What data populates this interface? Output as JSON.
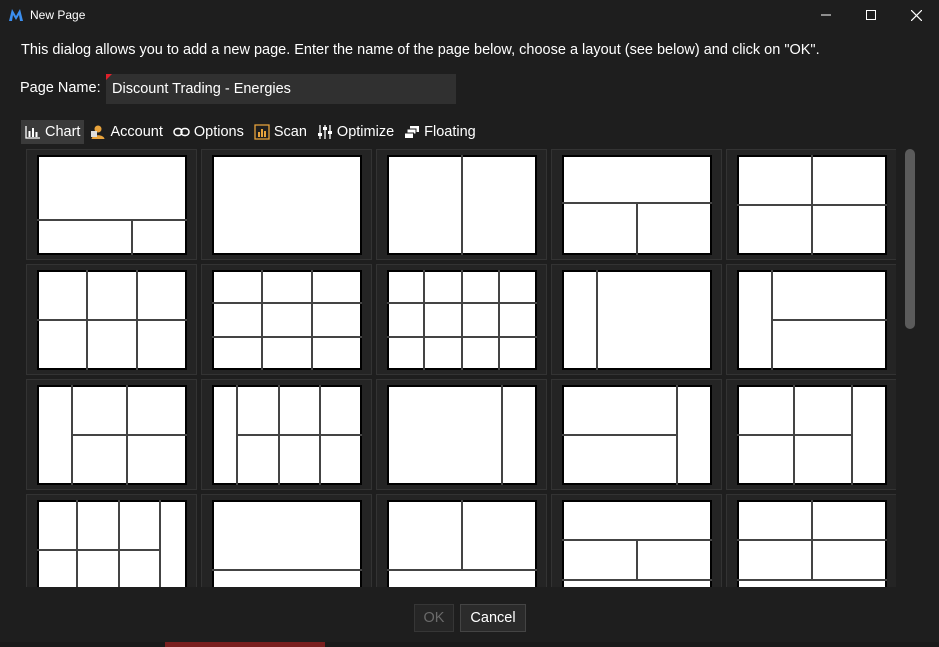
{
  "window": {
    "title": "New Page",
    "logo_icon": "multicharts-logo-icon"
  },
  "dialog": {
    "description": "This dialog allows you to add a new page.  Enter the name of the page below, choose a layout (see below) and click on \"OK\".",
    "page_name_label": "Page Name:",
    "page_name_value": "Discount Trading - Energies"
  },
  "tabs": [
    {
      "label": "Chart",
      "icon": "bar-chart-icon",
      "active": true
    },
    {
      "label": "Account",
      "icon": "account-icon",
      "active": false
    },
    {
      "label": "Options",
      "icon": "link-icon",
      "active": false
    },
    {
      "label": "Scan",
      "icon": "scan-icon",
      "active": false
    },
    {
      "label": "Optimize",
      "icon": "sliders-icon",
      "active": false
    },
    {
      "label": "Floating",
      "icon": "floating-windows-icon",
      "active": false
    }
  ],
  "footer": {
    "ok_label": "OK",
    "ok_enabled": false,
    "cancel_label": "Cancel"
  },
  "colors": {
    "background": "#1e1e1e",
    "input_bg": "#303030",
    "accent_red": "#e0202a",
    "icon_orange": "#e8a33c"
  }
}
